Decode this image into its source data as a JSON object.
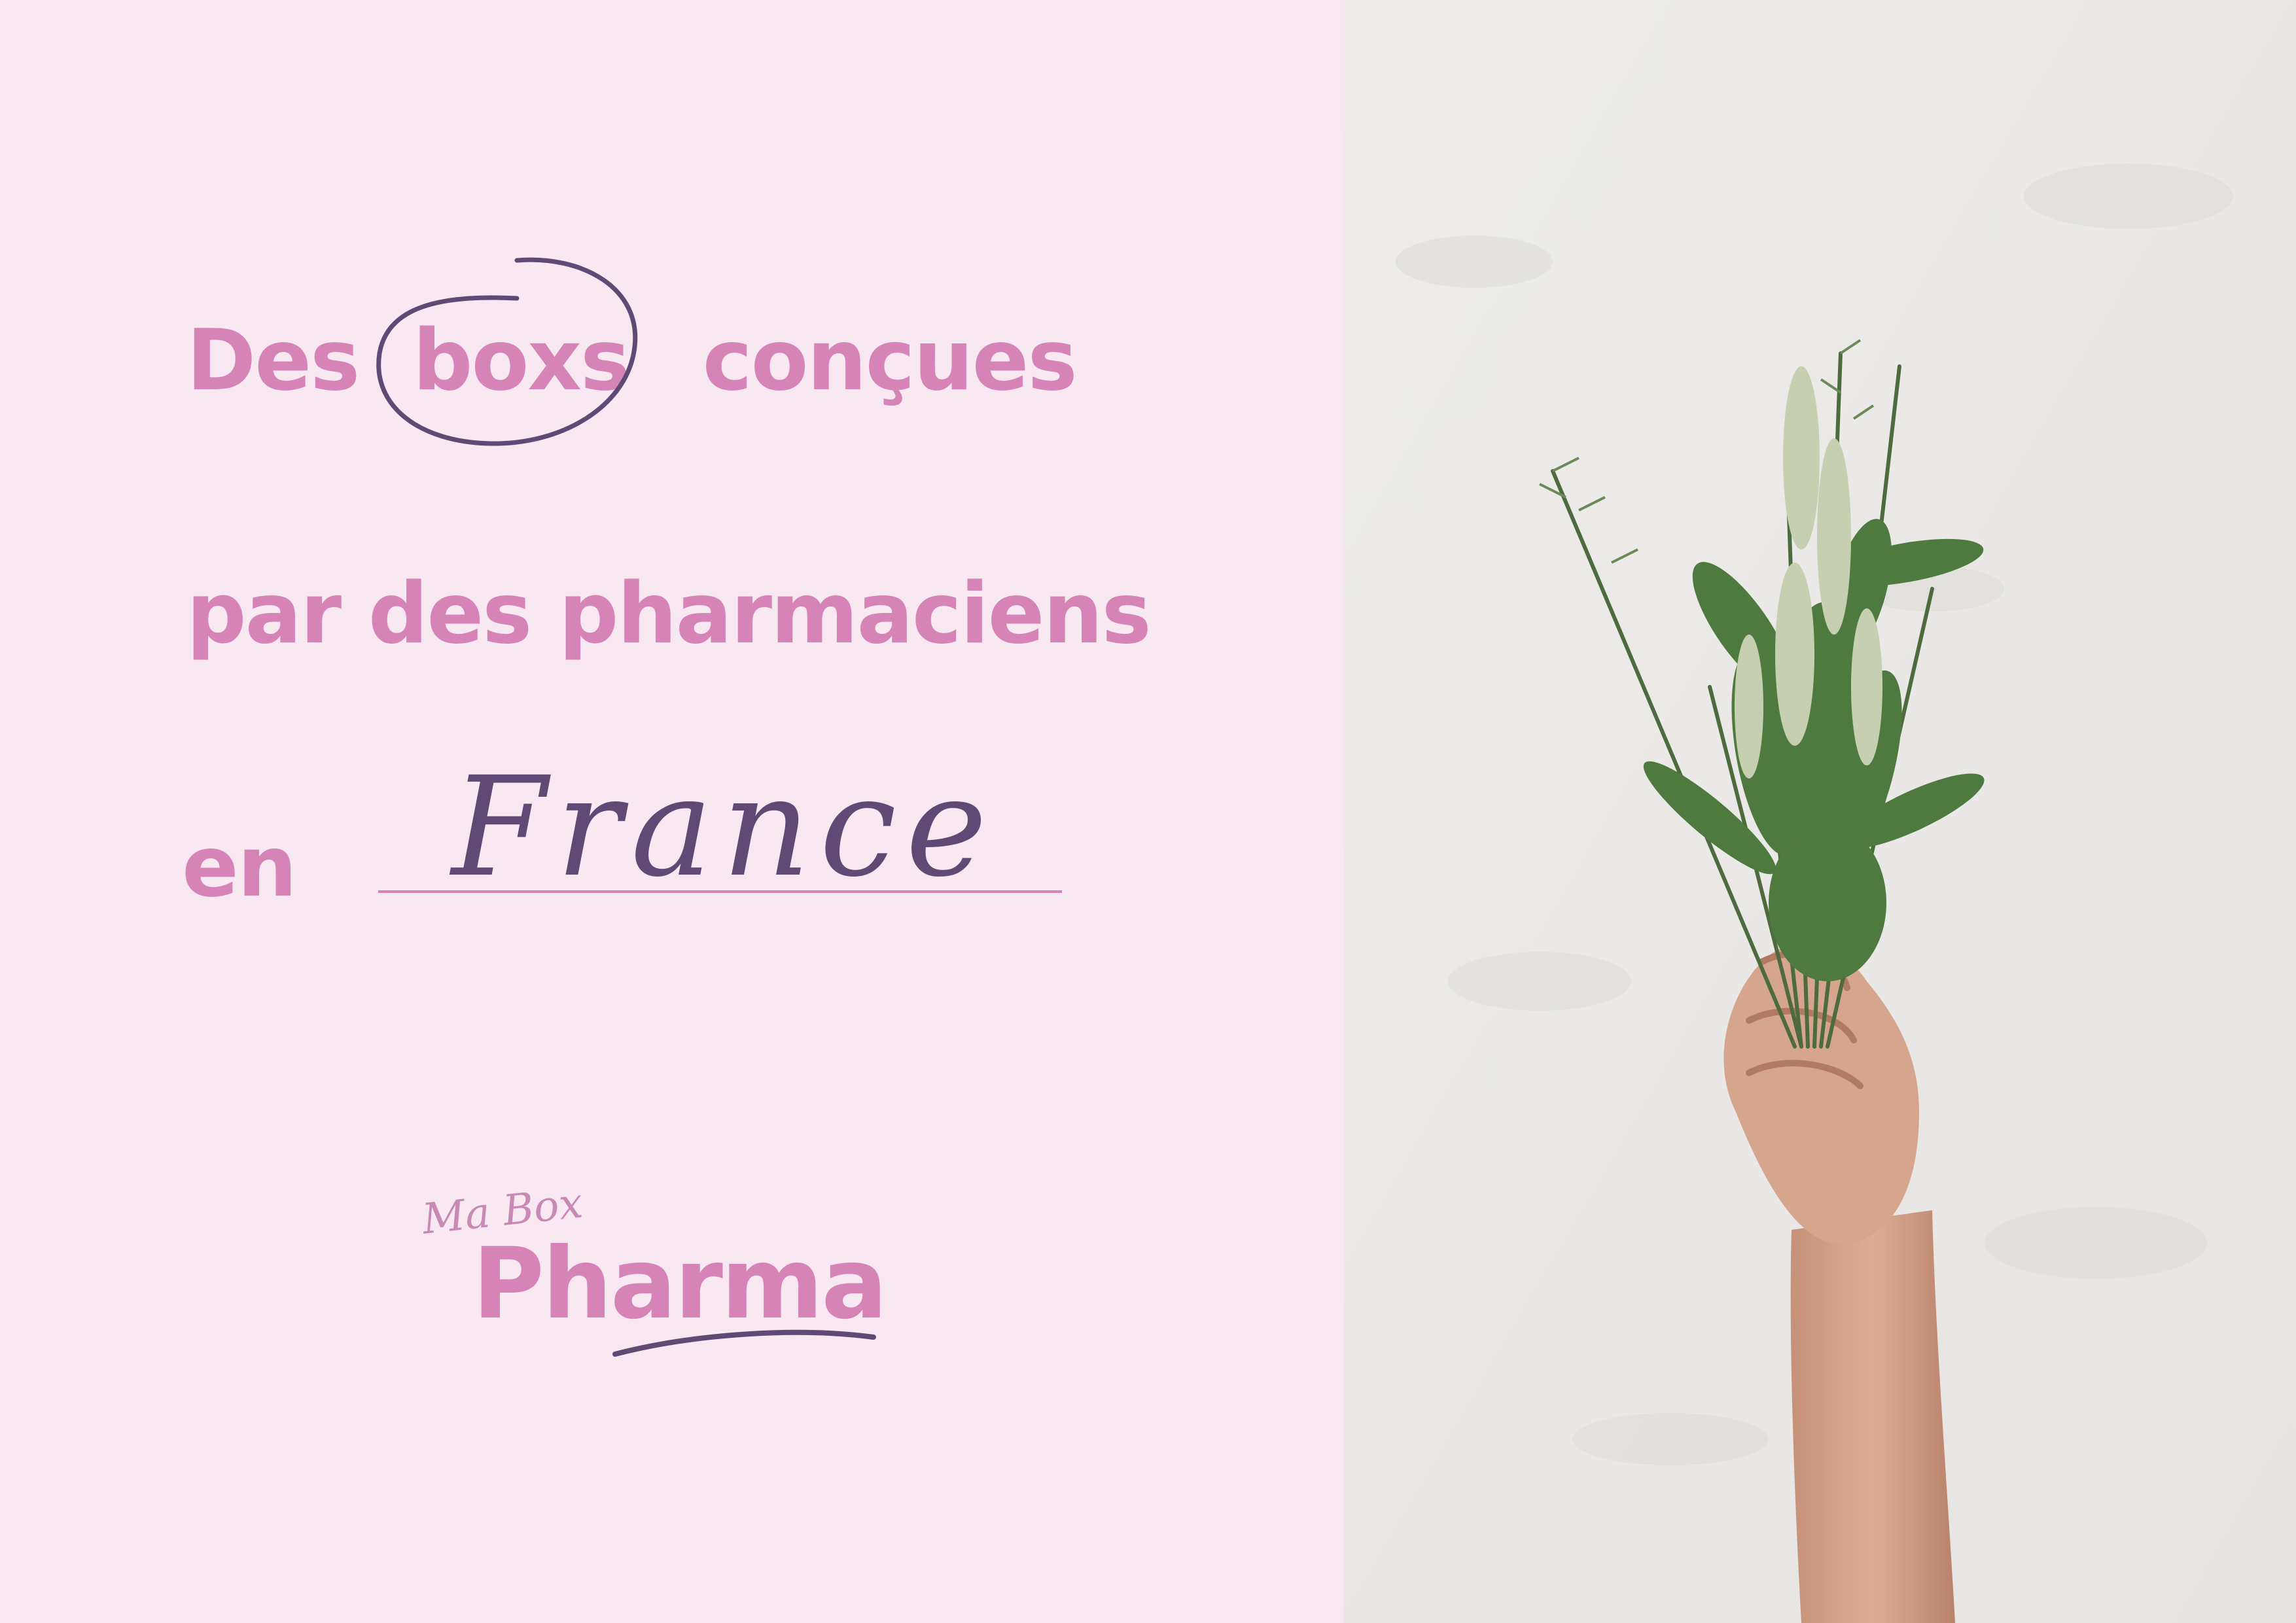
{
  "headline": {
    "line1": {
      "before": "Des",
      "circled": "boxs",
      "after": "conçues"
    },
    "line2": "par des pharmaciens",
    "line3": {
      "prefix": "en",
      "handwritten": "France"
    }
  },
  "logo": {
    "script": "Ma Box",
    "word": "Pharma"
  },
  "colors": {
    "background_left": "#f7e8f2",
    "text_pink": "#d683b7",
    "ink_purple": "#5e4a75",
    "wall": "#ebe9e7"
  },
  "photo": {
    "subject": "hand holding herb bouquet against white wall"
  }
}
